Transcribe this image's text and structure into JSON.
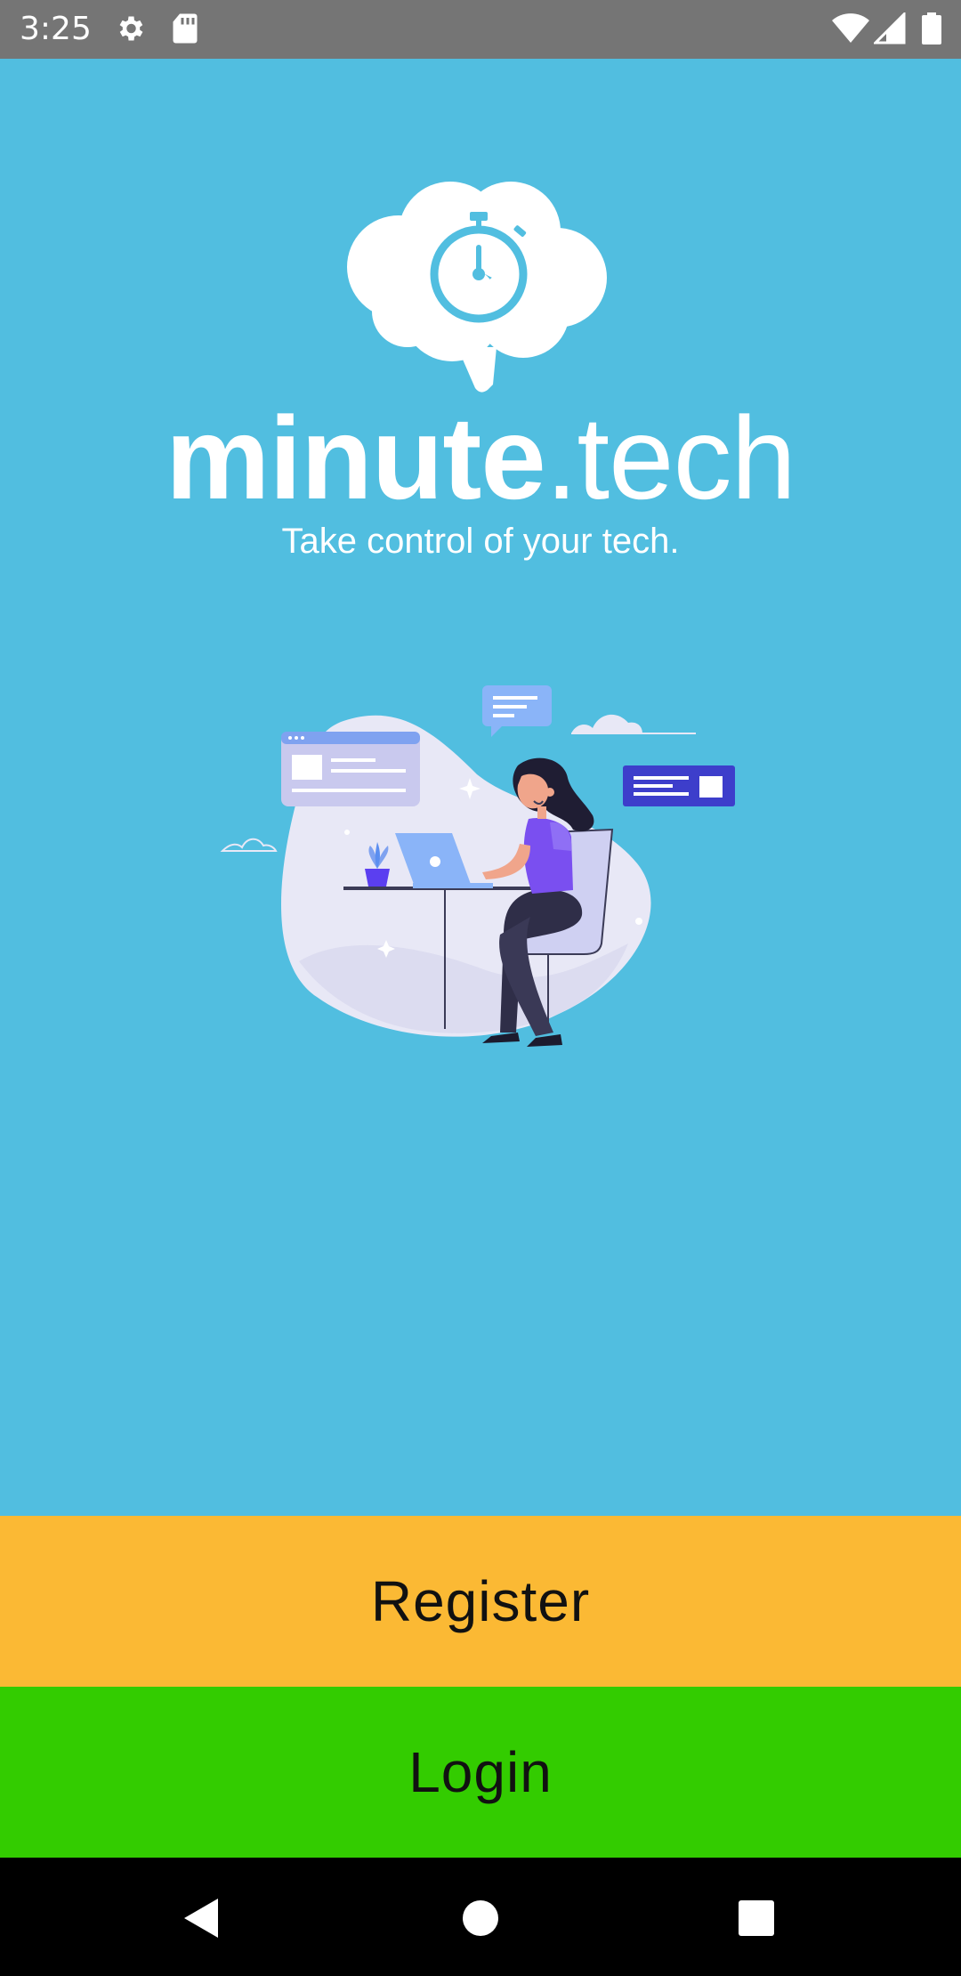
{
  "status_bar": {
    "time": "3:25",
    "icons": [
      "settings-icon",
      "sd-card-icon",
      "wifi-icon",
      "signal-icon",
      "battery-icon"
    ]
  },
  "brand": {
    "name_bold": "minute",
    "name_light": ".tech",
    "tagline": "Take control of your tech."
  },
  "actions": {
    "register_label": "Register",
    "login_label": "Login"
  },
  "nav_bar": {
    "icons": [
      "back-icon",
      "home-icon",
      "recents-icon"
    ]
  },
  "colors": {
    "background": "#51bee0",
    "status_bar": "#757575",
    "register": "#fbb934",
    "login": "#33cc00",
    "nav_bar": "#000000"
  }
}
